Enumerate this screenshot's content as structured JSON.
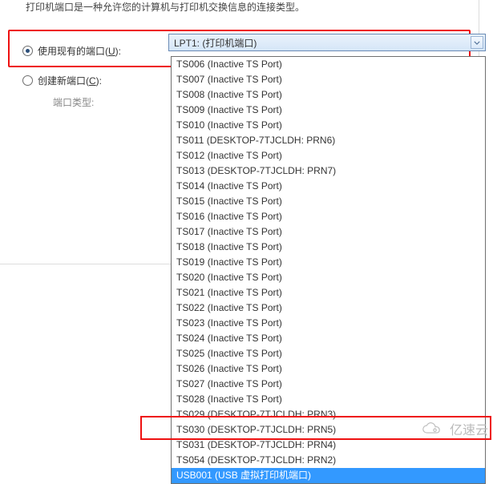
{
  "description": "打印机端口是一种允许您的计算机与打印机交换信息的连接类型。",
  "radio_use_existing": {
    "label_pre": "使用现有的端口(",
    "key": "U",
    "label_post": "):"
  },
  "radio_create_new": {
    "label_pre": "创建新端口(",
    "key": "C",
    "label_post": "):"
  },
  "combo_value": "LPT1: (打印机端口)",
  "port_type_label": "端口类型:",
  "watermark_text": "亿速云",
  "dropdown_items": [
    "TS006 (Inactive TS Port)",
    "TS007 (Inactive TS Port)",
    "TS008 (Inactive TS Port)",
    "TS009 (Inactive TS Port)",
    "TS010 (Inactive TS Port)",
    "TS011 (DESKTOP-7TJCLDH: PRN6)",
    "TS012 (Inactive TS Port)",
    "TS013 (DESKTOP-7TJCLDH: PRN7)",
    "TS014 (Inactive TS Port)",
    "TS015 (Inactive TS Port)",
    "TS016 (Inactive TS Port)",
    "TS017 (Inactive TS Port)",
    "TS018 (Inactive TS Port)",
    "TS019 (Inactive TS Port)",
    "TS020 (Inactive TS Port)",
    "TS021 (Inactive TS Port)",
    "TS022 (Inactive TS Port)",
    "TS023 (Inactive TS Port)",
    "TS024 (Inactive TS Port)",
    "TS025 (Inactive TS Port)",
    "TS026 (Inactive TS Port)",
    "TS027 (Inactive TS Port)",
    "TS028 (Inactive TS Port)",
    "TS029 (DESKTOP-7TJCLDH: PRN3)",
    "TS030 (DESKTOP-7TJCLDH: PRN5)",
    "TS031 (DESKTOP-7TJCLDH: PRN4)",
    "TS054 (DESKTOP-7TJCLDH: PRN2)",
    "USB001 (USB 虚拟打印机端口)"
  ],
  "dropdown_selected_index": 27
}
